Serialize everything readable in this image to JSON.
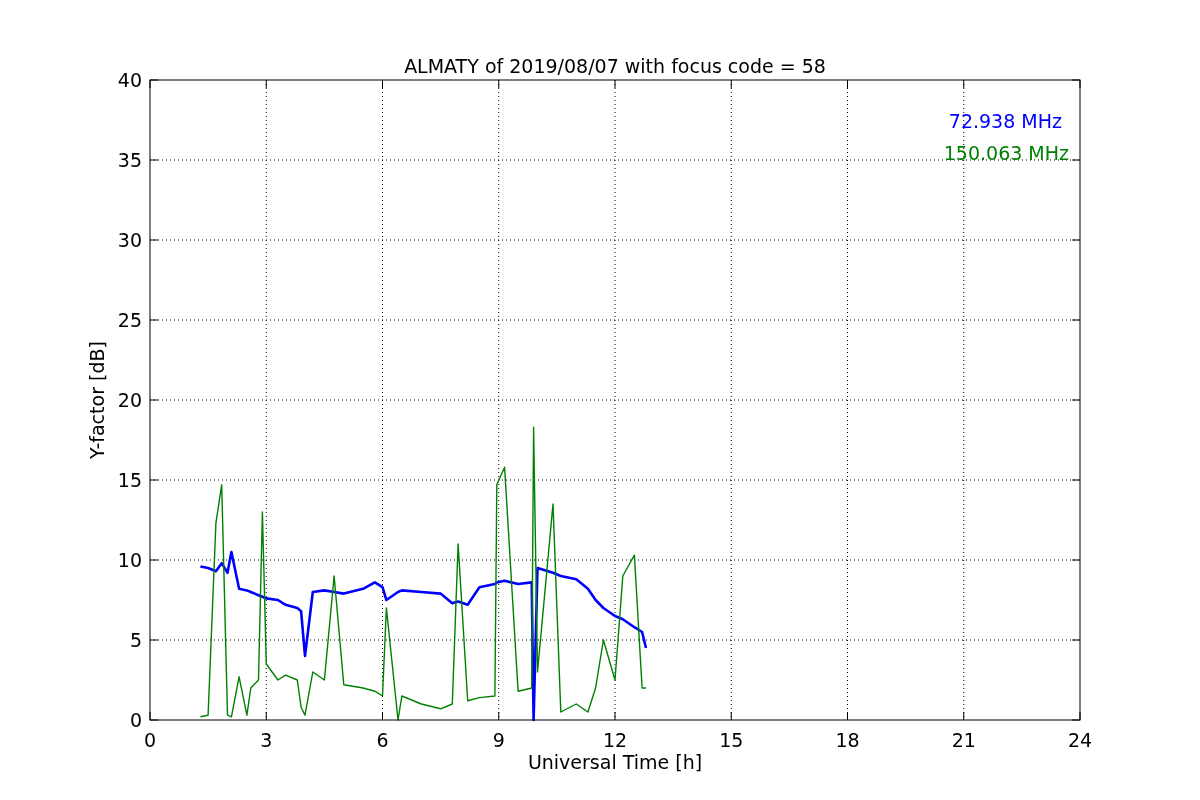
{
  "chart_data": {
    "type": "line",
    "title": "ALMATY of 2019/08/07 with focus code = 58",
    "xlabel": "Universal Time [h]",
    "ylabel": "Y-factor [dB]",
    "x": [
      1.3,
      1.5,
      1.7,
      1.85,
      2.0,
      2.1,
      2.3,
      2.5,
      2.6,
      2.8,
      2.9,
      3.0,
      3.3,
      3.5,
      3.8,
      3.9,
      4.0,
      4.2,
      4.5,
      4.75,
      5.0,
      5.5,
      5.8,
      6.0,
      6.1,
      6.4,
      6.5,
      7.0,
      7.5,
      7.8,
      7.95,
      8.2,
      8.5,
      8.9,
      8.95,
      9.15,
      9.5,
      9.85,
      9.9,
      10.0,
      10.4,
      10.6,
      11.0,
      11.3,
      11.5,
      11.7,
      12.0,
      12.2,
      12.5,
      12.7,
      12.8
    ],
    "series": [
      {
        "name": "72.938 MHz",
        "color": "#0000ff",
        "values": [
          9.6,
          9.5,
          9.3,
          9.8,
          9.2,
          10.5,
          8.2,
          8.1,
          8.0,
          7.8,
          7.7,
          7.6,
          7.5,
          7.2,
          7.0,
          6.8,
          4.0,
          8.0,
          8.1,
          8.0,
          7.9,
          8.2,
          8.6,
          8.3,
          7.5,
          8.0,
          8.1,
          8.0,
          7.9,
          7.3,
          7.4,
          7.2,
          8.3,
          8.5,
          8.6,
          8.7,
          8.5,
          8.6,
          0,
          9.5,
          9.2,
          9.0,
          8.8,
          8.2,
          7.5,
          7.0,
          6.5,
          6.3,
          5.8,
          5.5,
          4.5
        ]
      },
      {
        "name": "150.063 MHz",
        "color": "#008000",
        "values": [
          0.2,
          0.3,
          12.3,
          14.7,
          0.3,
          0.2,
          2.7,
          0.3,
          2.0,
          2.5,
          13.0,
          3.5,
          2.5,
          2.8,
          2.5,
          0.8,
          0.3,
          3.0,
          2.5,
          9.0,
          2.2,
          2.0,
          1.8,
          1.5,
          7.0,
          0,
          1.5,
          1.0,
          0.7,
          1.0,
          11.0,
          1.2,
          1.4,
          1.5,
          14.7,
          15.8,
          1.8,
          2.0,
          18.3,
          3.0,
          13.5,
          0.5,
          1.0,
          0.5,
          2.0,
          5.0,
          2.5,
          9.0,
          10.3,
          2.0,
          2.0
        ]
      }
    ],
    "xlim": [
      0,
      24
    ],
    "ylim": [
      0,
      40
    ],
    "xticks": [
      0,
      3,
      6,
      9,
      12,
      15,
      18,
      21,
      24
    ],
    "yticks": [
      0,
      5,
      10,
      15,
      20,
      25,
      30,
      35,
      40
    ],
    "grid": true
  }
}
